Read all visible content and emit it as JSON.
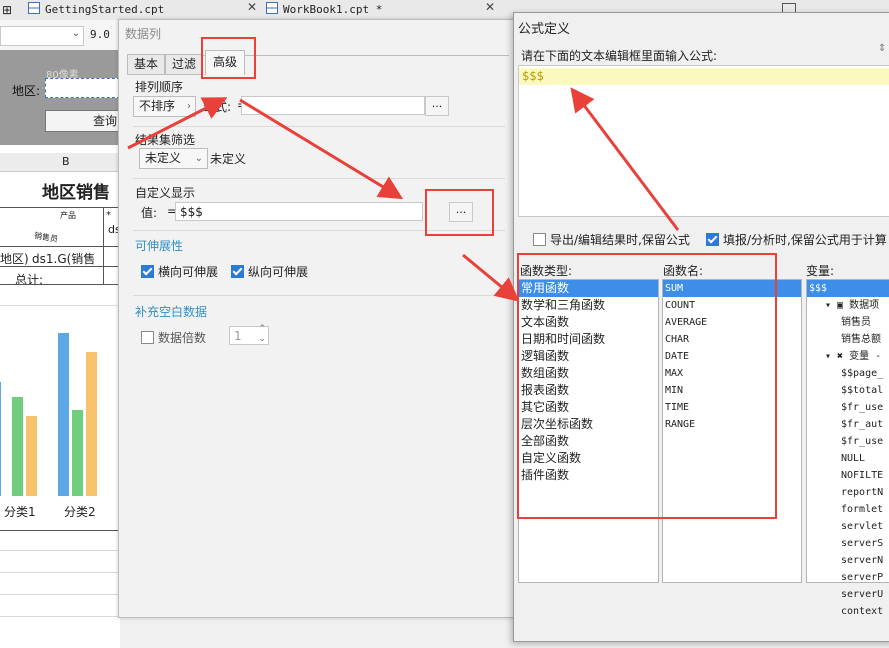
{
  "tabs": [
    {
      "label": "GettingStarted.cpt"
    },
    {
      "label": "WorkBook1.cpt *"
    }
  ],
  "toolbar": {
    "font_size": "9.0"
  },
  "sheet": {
    "ruler_label": "80像素",
    "region_label": "地区:",
    "query_button": "查询",
    "col_b": "B",
    "report_title": "地区销售",
    "hdr_product": "产品",
    "hdr_salesman": "销售员",
    "cell_region": "地区)",
    "cell_ds": "ds1.G(销售",
    "cell_ds_short": "ds",
    "cell_total": "总计:",
    "cat1": "分类1",
    "cat2": "分类2"
  },
  "chart_data": {
    "type": "bar",
    "categories": [
      "",
      "分类1",
      "分类2"
    ],
    "series": [
      {
        "values": [
          6,
          0,
          8.6
        ],
        "color": "#5aa9e6"
      },
      {
        "values": [
          0,
          5.2,
          4.5
        ],
        "color": "#6fcf7f"
      },
      {
        "values": [
          0,
          4.2,
          7.6
        ],
        "color": "#f6c26b"
      }
    ],
    "ylim": [
      0,
      10
    ]
  },
  "datacol": {
    "title": "数据列",
    "tabs": [
      "基本",
      "过滤",
      "高级"
    ],
    "sort": {
      "title": "排列顺序",
      "value": "不排序",
      "formula_label": "公式:",
      "formula_eq": "=",
      "dots": "..."
    },
    "filter": {
      "title": "结果集筛选",
      "value": "未定义",
      "value_text": "未定义"
    },
    "custom": {
      "title": "自定义显示",
      "label": "值:",
      "eq": "=",
      "value": "$$$",
      "dots": "..."
    },
    "expand": {
      "title": "可伸展性",
      "horizontal": "横向可伸展",
      "vertical": "纵向可伸展"
    },
    "fill": {
      "title": "补充空白数据",
      "multiple": "数据倍数",
      "multiple_value": "1"
    }
  },
  "formula": {
    "title": "公式定义",
    "prompt": "请在下面的文本编辑框里面输入公式:",
    "value": "$$$",
    "keep_export": "导出/编辑结果时,保留公式",
    "keep_fill": "填报/分析时,保留公式用于计算",
    "types_label": "函数类型:",
    "names_label": "函数名:",
    "vars_label": "变量:",
    "types": [
      "常用函数",
      "数学和三角函数",
      "文本函数",
      "日期和时间函数",
      "逻辑函数",
      "数组函数",
      "报表函数",
      "其它函数",
      "层次坐标函数",
      "全部函数",
      "自定义函数",
      "插件函数"
    ],
    "names": [
      "SUM",
      "COUNT",
      "AVERAGE",
      "CHAR",
      "DATE",
      "MAX",
      "MIN",
      "TIME",
      "RANGE"
    ],
    "vars": [
      "$$$",
      "数据项",
      "销售员",
      "销售总额",
      "变量 -",
      "$$page_",
      "$$total",
      "$fr_use",
      "$fr_aut",
      "$fr_use",
      "NULL",
      "NOFILTE",
      "reportN",
      "formlet",
      "servlet",
      "serverS",
      "serverN",
      "serverP",
      "serverU",
      "context"
    ]
  },
  "colors": {
    "accent": "#e8413a",
    "selection": "#3d8ee8",
    "formula_bg": "#fafac0",
    "section": "#2f8fc7"
  }
}
